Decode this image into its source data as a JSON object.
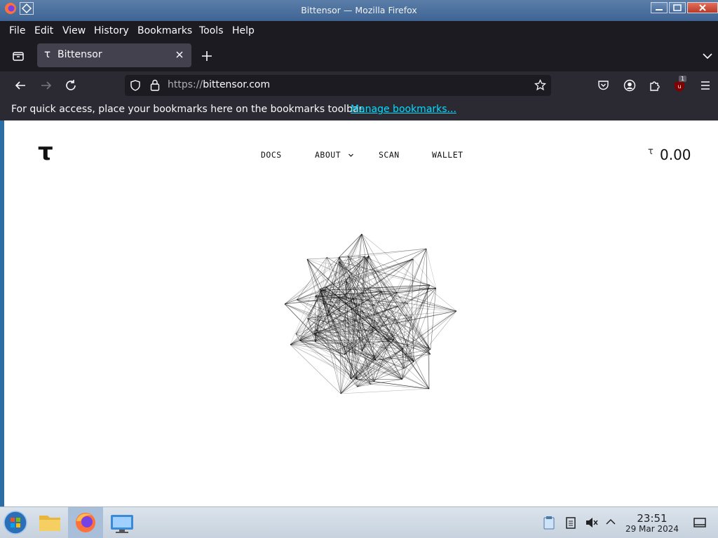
{
  "window": {
    "title": "Bittensor — Mozilla Firefox"
  },
  "menu": [
    "File",
    "Edit",
    "View",
    "History",
    "Bookmarks",
    "Tools",
    "Help"
  ],
  "tab": {
    "label": "Bittensor",
    "favicon": "τ"
  },
  "url": {
    "protocol": "https://",
    "host": "bittensor.com"
  },
  "toolbar": {
    "extension_badge": "1"
  },
  "bookmarks": {
    "message": "For quick access, place your bookmarks here on the bookmarks toolbar.",
    "manage_link": "Manage bookmarks..."
  },
  "site": {
    "logo": "τ",
    "nav": [
      "DOCS",
      "ABOUT",
      "SCAN",
      "WALLET"
    ],
    "balance_symbol": "τ",
    "balance": "0.00"
  },
  "taskbar": {
    "time": "23:51",
    "date": "29 Mar 2024"
  }
}
